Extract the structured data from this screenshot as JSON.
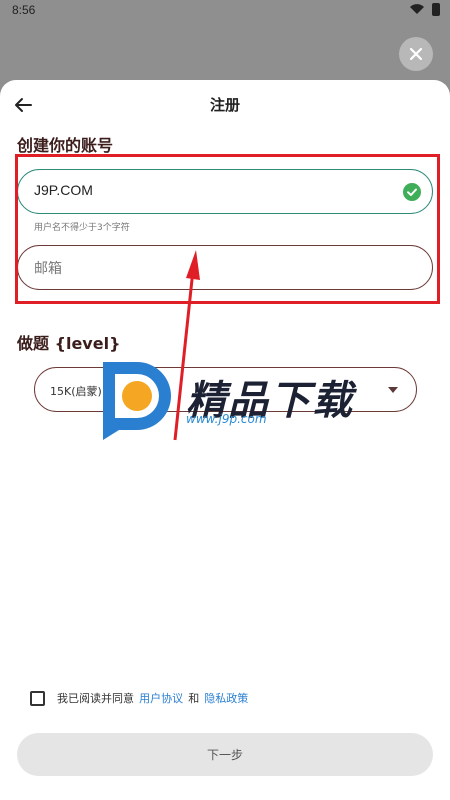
{
  "status_bar": {
    "time": "8:56",
    "wifi_icon": "wifi-icon",
    "battery_icon": "battery-icon"
  },
  "header": {
    "title": "注册",
    "back_icon": "arrow-left-icon"
  },
  "account_section": {
    "title": "创建你的账号",
    "username": {
      "value": "J9P.COM",
      "valid_icon": "check-circle-icon",
      "helper": "用户名不得少于3个字符"
    },
    "email": {
      "placeholder": "邮箱"
    }
  },
  "level_section": {
    "title": "做题 {level}",
    "selected": "15K(启蒙)"
  },
  "watermark": {
    "title": "精品下载",
    "url": "www.j9p.com"
  },
  "agreement": {
    "prefix": "我已阅读并同意",
    "terms": "用户协议",
    "and": "和",
    "privacy": "隐私政策"
  },
  "next_button": {
    "label": "下一步"
  },
  "colors": {
    "valid": "#2e8b7a",
    "accent": "#e01e26",
    "link": "#2a7fd0"
  }
}
